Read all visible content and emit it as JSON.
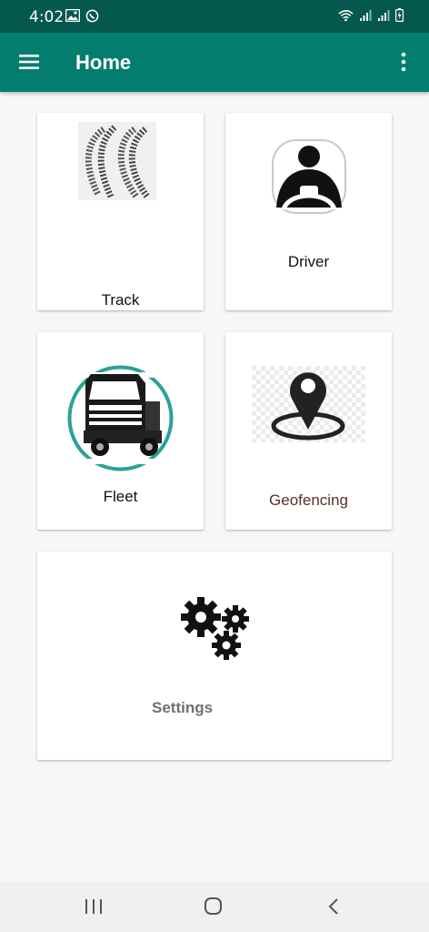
{
  "status_bar": {
    "time": "4:02",
    "icons": [
      "image-icon",
      "whatsapp-icon",
      "wifi-icon",
      "signal-icon",
      "signal-icon",
      "battery-icon"
    ]
  },
  "app_bar": {
    "title": "Home",
    "menu_icon": "hamburger-menu-icon",
    "overflow_icon": "more-vert-icon",
    "color": "#037e6e",
    "status_color": "#04584e"
  },
  "cards": {
    "track": {
      "label": "Track",
      "icon": "tire-tracks-icon"
    },
    "driver": {
      "label": "Driver",
      "icon": "driver-icon"
    },
    "fleet": {
      "label": "Fleet",
      "icon": "truck-icon"
    },
    "geofencing": {
      "label": "Geofencing",
      "icon": "map-pin-icon",
      "label_color": "#5b2f2f"
    },
    "settings": {
      "label": "Settings",
      "icon": "gears-icon",
      "label_color": "#6f6f6f"
    }
  },
  "nav_bar": {
    "buttons": [
      "recent-apps-icon",
      "home-icon",
      "back-icon"
    ]
  }
}
